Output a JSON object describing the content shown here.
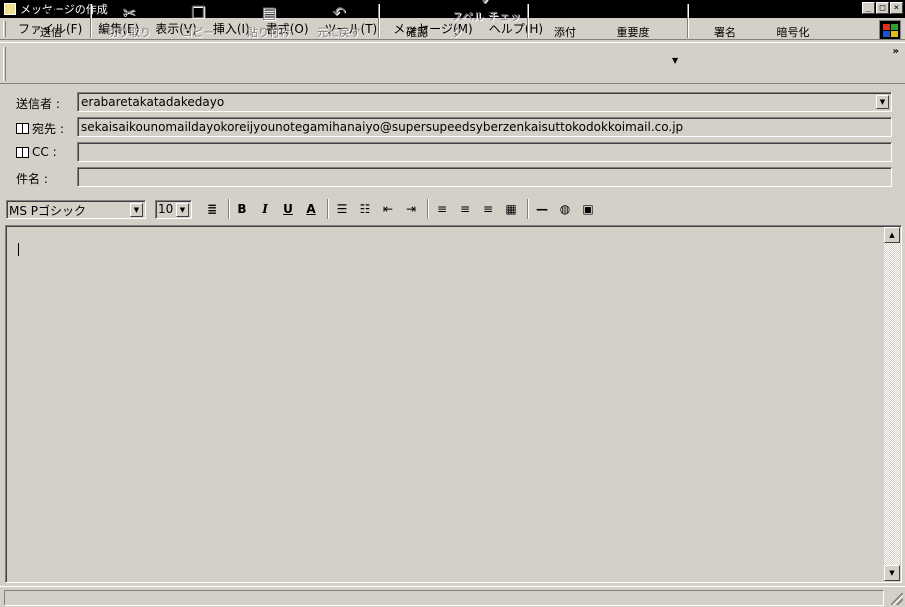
{
  "window": {
    "title": "メッセージの作成"
  },
  "menu": [
    {
      "label": "ファイル(F)"
    },
    {
      "label": "編集(E)"
    },
    {
      "label": "表示(V)"
    },
    {
      "label": "挿入(I)"
    },
    {
      "label": "書式(O)"
    },
    {
      "label": "ツール(T)"
    },
    {
      "label": "メッセージ(M)"
    },
    {
      "label": "ヘルプ(H)"
    }
  ],
  "toolbar": {
    "send": "送信",
    "cut": "切り取り",
    "copy": "コピー",
    "paste": "貼り付け",
    "undo": "元に戻す",
    "check": "確認",
    "spell": "スペル チェック",
    "attach": "添付",
    "priority": "重要度",
    "sign": "署名",
    "encrypt": "暗号化",
    "more": "»"
  },
  "header": {
    "from_label": "送信者 :",
    "from_value": "erabaretakatadakedayo",
    "to_label": "宛先 :",
    "to_value": "sekaisaikounomaildayokoreijyounotegamihanaiyo@supersupeedsyberzenkaisuttokodokkoimail.co.jp",
    "cc_label": "CC :",
    "cc_value": "",
    "subject_label": "件名 :",
    "subject_value": ""
  },
  "format": {
    "font": "MS Pゴシック",
    "size": "10",
    "bold": "B",
    "italic": "I",
    "underline": "U",
    "font_color": "A"
  },
  "colors": {
    "window_bg": "#d4d0c8",
    "titlebar": "#000000"
  }
}
